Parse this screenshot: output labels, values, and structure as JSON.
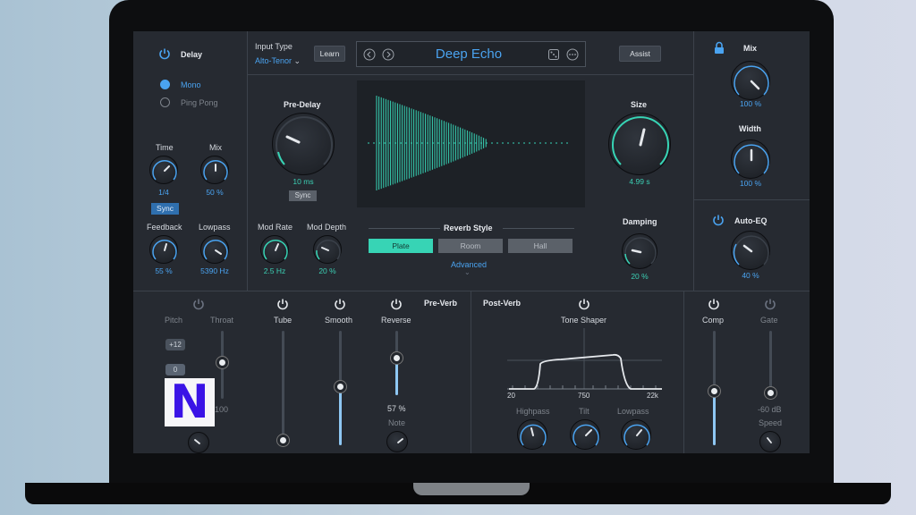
{
  "colors": {
    "accent_blue": "#4aa3f0",
    "accent_green": "#37d4b5",
    "panel": "#262a31"
  },
  "delay": {
    "title": "Delay",
    "modes": [
      {
        "label": "Mono",
        "selected": true
      },
      {
        "label": "Ping Pong",
        "selected": false
      }
    ],
    "time": {
      "label": "Time",
      "value": "1/4"
    },
    "mix": {
      "label": "Mix",
      "value": "50 %"
    },
    "sync_label": "Sync",
    "feedback": {
      "label": "Feedback",
      "value": "55 %"
    },
    "lowpass": {
      "label": "Lowpass",
      "value": "5390 Hz"
    }
  },
  "header": {
    "input_type_label": "Input Type",
    "input_type_value": "Alto-Tenor",
    "learn_label": "Learn",
    "preset_name": "Deep Echo",
    "assist_label": "Assist"
  },
  "reverb": {
    "predelay": {
      "label": "Pre-Delay",
      "value": "10 ms"
    },
    "sync_label": "Sync",
    "size": {
      "label": "Size",
      "value": "4.99 s"
    },
    "damping": {
      "label": "Damping",
      "value": "20 %"
    },
    "mod_rate": {
      "label": "Mod Rate",
      "value": "2.5 Hz"
    },
    "mod_depth": {
      "label": "Mod Depth",
      "value": "20 %"
    },
    "style_label": "Reverb Style",
    "styles": [
      {
        "label": "Plate",
        "active": true
      },
      {
        "label": "Room",
        "active": false
      },
      {
        "label": "Hall",
        "active": false
      }
    ],
    "advanced_label": "Advanced"
  },
  "output": {
    "mix": {
      "label": "Mix",
      "value": "100 %"
    },
    "width": {
      "label": "Width",
      "value": "100 %"
    },
    "autoeq": {
      "label": "Auto-EQ",
      "value": "40 %"
    }
  },
  "preverb": {
    "title": "Pre-Verb",
    "pitch_label": "Pitch",
    "pitch_tags": [
      "+12",
      "0"
    ],
    "throat_label": "Throat",
    "throat_value_partial": "100",
    "tube_label": "Tube",
    "smooth_label": "Smooth",
    "reverse_label": "Reverse",
    "reverse_value": "57 %",
    "note_label": "Note"
  },
  "postverb": {
    "title": "Post-Verb",
    "tone_shaper_label": "Tone Shaper",
    "graph_ticks": [
      "20",
      "750",
      "22k"
    ],
    "highpass_label": "Highpass",
    "tilt_label": "Tilt",
    "lowpass_label": "Lowpass",
    "comp_label": "Comp",
    "gate_label": "Gate",
    "gate_value": "-60 dB",
    "speed_label": "Speed"
  },
  "watermark_letter": "N"
}
